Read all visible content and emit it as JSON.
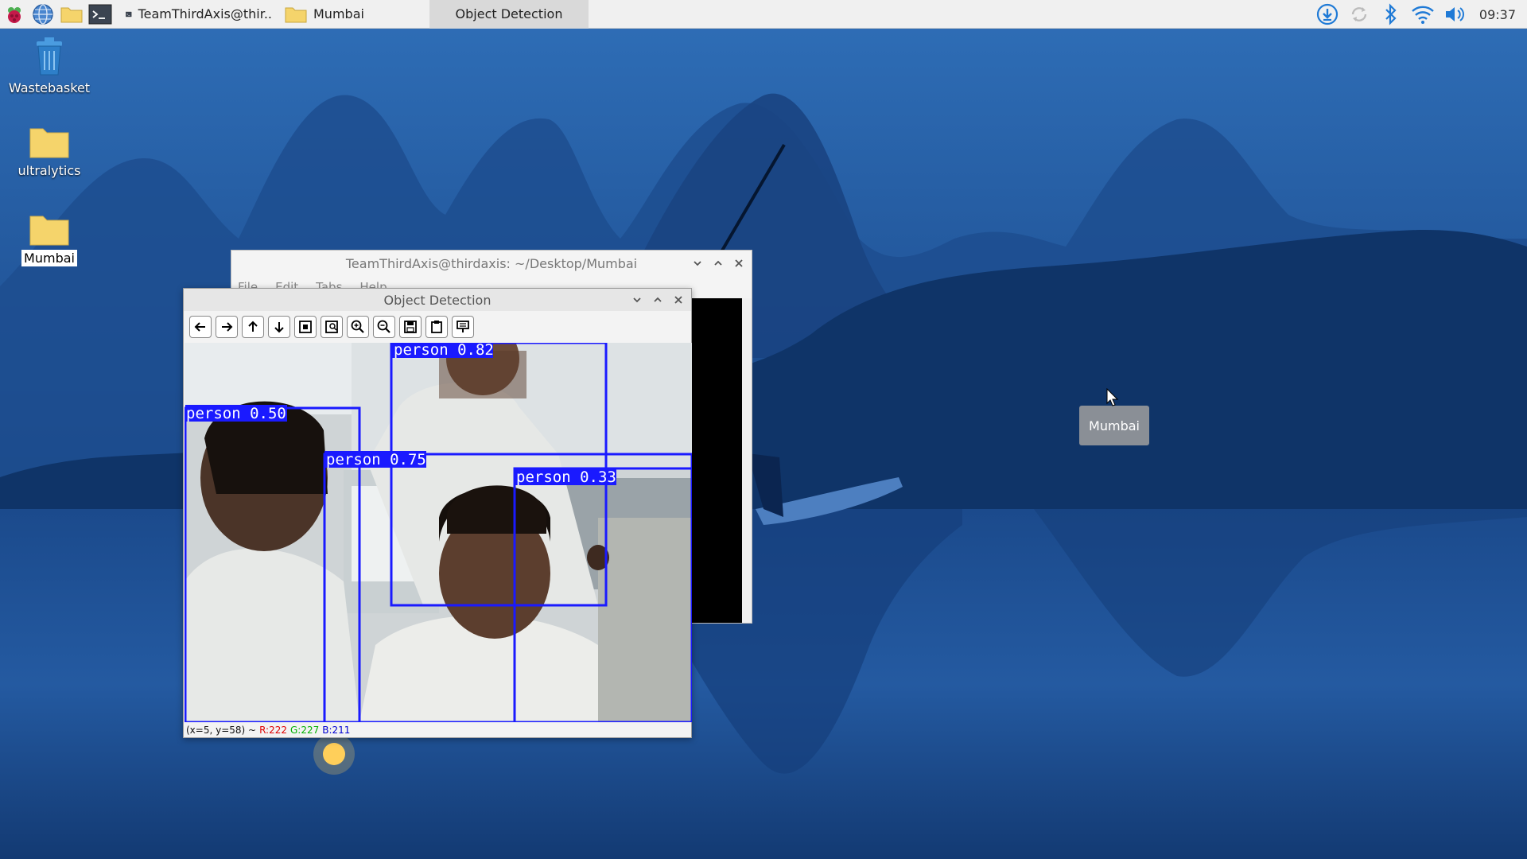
{
  "taskbar": {
    "tasks": [
      {
        "label": "TeamThirdAxis@thir..",
        "icon": "terminal-icon"
      },
      {
        "label": "Mumbai",
        "icon": "folder-icon"
      },
      {
        "label": "Object Detection",
        "icon": "",
        "active": true
      }
    ],
    "launchers": [
      "raspberry-menu-icon",
      "web-browser-icon",
      "file-manager-icon",
      "terminal-icon"
    ],
    "tray": [
      "download-update-icon",
      "sync-icon",
      "bluetooth-icon",
      "wifi-icon",
      "volume-icon"
    ],
    "clock": "09:37"
  },
  "desktop": {
    "icons": [
      {
        "label": "Wastebasket",
        "icon": "trash-icon"
      },
      {
        "label": "ultralytics",
        "icon": "folder-icon"
      },
      {
        "label": "Mumbai",
        "icon": "folder-icon",
        "selected": true
      }
    ]
  },
  "terminal": {
    "title": "TeamThirdAxis@thirdaxis: ~/Desktop/Mumbai",
    "menu": [
      "File",
      "Edit",
      "Tabs",
      "Help"
    ]
  },
  "object_detection": {
    "title": "Object Detection",
    "toolbar": [
      "pan-left-icon",
      "pan-right-icon",
      "pan-up-icon",
      "pan-down-icon",
      "zoom-fit-icon",
      "zoom-original-icon",
      "zoom-in-icon",
      "zoom-out-icon",
      "save-image-icon",
      "copy-to-clipboard-icon",
      "properties-icon"
    ],
    "detections": [
      {
        "label": "person 0.82"
      },
      {
        "label": "person 0.50"
      },
      {
        "label": "person 0.75"
      },
      {
        "label": "person 0.33"
      }
    ],
    "status": {
      "coords": "(x=5, y=58) ~",
      "r": "R:222",
      "g": "G:227",
      "b": "B:211"
    }
  },
  "tooltip": {
    "text": "Mumbai"
  },
  "colors": {
    "taskbar_bg": "#f0f0f0",
    "box_blue": "#1a1aff",
    "status_r": "#e00000",
    "status_g": "#00b000",
    "status_b": "#0000d0"
  }
}
